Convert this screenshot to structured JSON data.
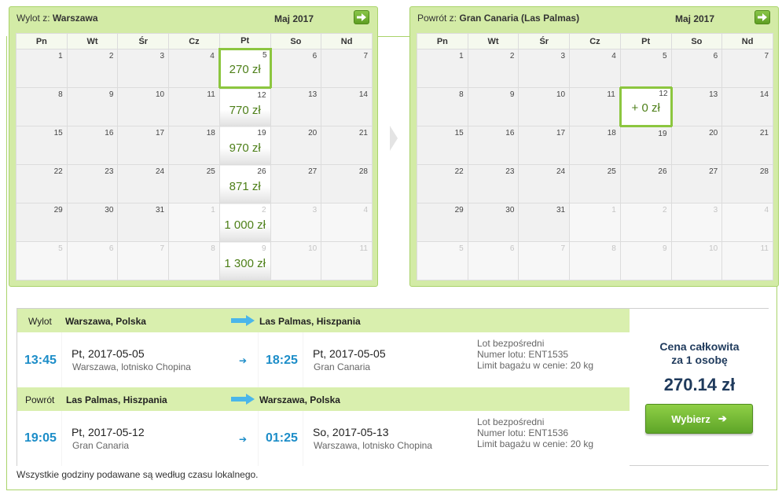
{
  "outbound_calendar": {
    "label": "Wylot z:",
    "city": "Warszawa",
    "month": "Maj 2017",
    "weekdays": [
      "Pn",
      "Wt",
      "Śr",
      "Cz",
      "Pt",
      "So",
      "Nd"
    ],
    "weeks": [
      [
        {
          "d": "1"
        },
        {
          "d": "2"
        },
        {
          "d": "3"
        },
        {
          "d": "4"
        },
        {
          "d": "5",
          "p": "270 zł",
          "sel": true
        },
        {
          "d": "6"
        },
        {
          "d": "7"
        }
      ],
      [
        {
          "d": "8"
        },
        {
          "d": "9"
        },
        {
          "d": "10"
        },
        {
          "d": "11"
        },
        {
          "d": "12",
          "p": "770 zł"
        },
        {
          "d": "13"
        },
        {
          "d": "14"
        }
      ],
      [
        {
          "d": "15"
        },
        {
          "d": "16"
        },
        {
          "d": "17"
        },
        {
          "d": "18"
        },
        {
          "d": "19",
          "p": "970 zł"
        },
        {
          "d": "20"
        },
        {
          "d": "21"
        }
      ],
      [
        {
          "d": "22"
        },
        {
          "d": "23"
        },
        {
          "d": "24"
        },
        {
          "d": "25"
        },
        {
          "d": "26",
          "p": "871 zł"
        },
        {
          "d": "27"
        },
        {
          "d": "28"
        }
      ],
      [
        {
          "d": "29"
        },
        {
          "d": "30"
        },
        {
          "d": "31"
        },
        {
          "d": "1",
          "o": true
        },
        {
          "d": "2",
          "o": true,
          "p": "1 000 zł"
        },
        {
          "d": "3",
          "o": true
        },
        {
          "d": "4",
          "o": true
        }
      ],
      [
        {
          "d": "5",
          "o": true
        },
        {
          "d": "6",
          "o": true
        },
        {
          "d": "7",
          "o": true
        },
        {
          "d": "8",
          "o": true
        },
        {
          "d": "9",
          "o": true,
          "p": "1 300 zł"
        },
        {
          "d": "10",
          "o": true
        },
        {
          "d": "11",
          "o": true
        }
      ]
    ]
  },
  "return_calendar": {
    "label": "Powrót z:",
    "city": "Gran Canaria (Las Palmas)",
    "month": "Maj 2017",
    "weekdays": [
      "Pn",
      "Wt",
      "Śr",
      "Cz",
      "Pt",
      "So",
      "Nd"
    ],
    "weeks": [
      [
        {
          "d": "1"
        },
        {
          "d": "2"
        },
        {
          "d": "3"
        },
        {
          "d": "4"
        },
        {
          "d": "5"
        },
        {
          "d": "6"
        },
        {
          "d": "7"
        }
      ],
      [
        {
          "d": "8"
        },
        {
          "d": "9"
        },
        {
          "d": "10"
        },
        {
          "d": "11"
        },
        {
          "d": "12",
          "p": "+ 0 zł",
          "sel": true
        },
        {
          "d": "13"
        },
        {
          "d": "14"
        }
      ],
      [
        {
          "d": "15"
        },
        {
          "d": "16"
        },
        {
          "d": "17"
        },
        {
          "d": "18"
        },
        {
          "d": "19"
        },
        {
          "d": "20"
        },
        {
          "d": "21"
        }
      ],
      [
        {
          "d": "22"
        },
        {
          "d": "23"
        },
        {
          "d": "24"
        },
        {
          "d": "25"
        },
        {
          "d": "26"
        },
        {
          "d": "27"
        },
        {
          "d": "28"
        }
      ],
      [
        {
          "d": "29"
        },
        {
          "d": "30"
        },
        {
          "d": "31"
        },
        {
          "d": "1",
          "o": true
        },
        {
          "d": "2",
          "o": true
        },
        {
          "d": "3",
          "o": true
        },
        {
          "d": "4",
          "o": true
        }
      ],
      [
        {
          "d": "5",
          "o": true
        },
        {
          "d": "6",
          "o": true
        },
        {
          "d": "7",
          "o": true
        },
        {
          "d": "8",
          "o": true
        },
        {
          "d": "9",
          "o": true
        },
        {
          "d": "10",
          "o": true
        },
        {
          "d": "11",
          "o": true
        }
      ]
    ]
  },
  "outbound_leg": {
    "type": "Wylot",
    "from": "Warszawa, Polska",
    "to": "Las Palmas, Hiszpania",
    "dep_time": "13:45",
    "dep_day": "Pt",
    "dep_date": "2017-05-05",
    "dep_airport": "Warszawa, lotnisko Chopina",
    "arr_time": "18:25",
    "arr_day": "Pt",
    "arr_date": "2017-05-05",
    "arr_airport": "Gran Canaria",
    "info_1": "Lot bezpośredni",
    "info_2": "Numer lotu: ENT1535",
    "info_3": "Limit bagażu w cenie: 20 kg"
  },
  "return_leg": {
    "type": "Powrót",
    "from": "Las Palmas, Hiszpania",
    "to": "Warszawa, Polska",
    "dep_time": "19:05",
    "dep_day": "Pt",
    "dep_date": "2017-05-12",
    "dep_airport": "Gran Canaria",
    "arr_time": "01:25",
    "arr_day": "So",
    "arr_date": "2017-05-13",
    "arr_airport": "Warszawa, lotnisko Chopina",
    "info_1": "Lot bezpośredni",
    "info_2": "Numer lotu: ENT1536",
    "info_3": "Limit bagażu w cenie: 20 kg"
  },
  "price": {
    "label_line1": "Cena całkowita",
    "label_line2": "za 1 osobę",
    "total": "270.14 zł",
    "button_label": "Wybierz",
    "button_arrow": "➔"
  },
  "row_arrow": "➔",
  "footnote": "Wszystkie godziny podawane są według czasu lokalnego.",
  "colors": {
    "panel_green": "#d3eba6",
    "price_green": "#4d7f18",
    "time_blue": "#1c8dc8",
    "total_navy": "#1f3a5c",
    "button_green": "#5ea528"
  }
}
